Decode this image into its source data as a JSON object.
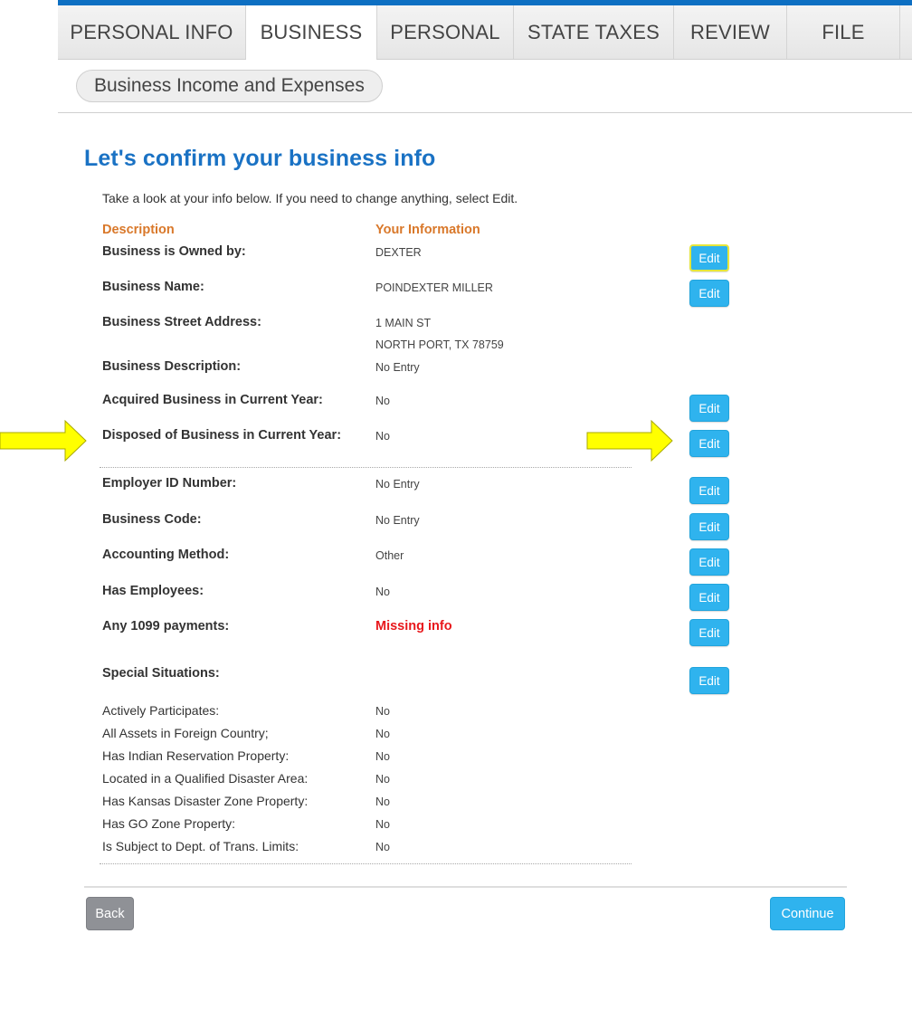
{
  "tabs": [
    {
      "label": "PERSONAL INFO"
    },
    {
      "label": "BUSINESS"
    },
    {
      "label": "PERSONAL"
    },
    {
      "label": "STATE TAXES"
    },
    {
      "label": "REVIEW"
    },
    {
      "label": "FILE"
    }
  ],
  "active_tab": "BUSINESS",
  "subnav": {
    "label": "Business Income and Expenses"
  },
  "page": {
    "title": "Let's confirm your business info",
    "intro": "Take a look at your info below. If you need to change anything, select Edit.",
    "col_description": "Description",
    "col_info": "Your Information"
  },
  "rows": {
    "owned_by": {
      "label": "Business is Owned by:",
      "value": "DEXTER"
    },
    "name": {
      "label": "Business Name:",
      "value": "POINDEXTER MILLER"
    },
    "address": {
      "label": "Business Street Address:",
      "line1": "1 MAIN ST",
      "line2": "NORTH PORT, TX 78759"
    },
    "description": {
      "label": "Business Description:",
      "value": "No Entry"
    },
    "acquired": {
      "label": "Acquired Business in Current Year:",
      "value": "No"
    },
    "disposed": {
      "label": "Disposed of Business in Current Year:",
      "value": "No"
    },
    "ein": {
      "label": "Employer ID Number:",
      "value": "No Entry"
    },
    "code": {
      "label": "Business Code:",
      "value": "No Entry"
    },
    "accounting": {
      "label": "Accounting Method:",
      "value": "Other"
    },
    "employees": {
      "label": "Has Employees:",
      "value": "No"
    },
    "payments_1099": {
      "label": "Any 1099 payments:",
      "value": "Missing info"
    },
    "special": {
      "label": "Special Situations:"
    }
  },
  "special_situations": [
    {
      "label": "Actively Participates:",
      "value": "No"
    },
    {
      "label": "All Assets in Foreign Country;",
      "value": "No"
    },
    {
      "label": "Has Indian Reservation Property:",
      "value": "No"
    },
    {
      "label": "Located in a Qualified Disaster Area:",
      "value": "No"
    },
    {
      "label": "Has Kansas Disaster Zone Property:",
      "value": "No"
    },
    {
      "label": "Has GO Zone Property:",
      "value": "No"
    },
    {
      "label": "Is Subject to Dept. of Trans. Limits:",
      "value": "No"
    }
  ],
  "buttons": {
    "edit": "Edit",
    "back": "Back",
    "continue": "Continue"
  },
  "colors": {
    "brand_blue": "#1a72c4",
    "button_blue": "#2fb3ee",
    "heading_orange": "#d9782a",
    "missing_red": "#e8181c",
    "arrow_yellow": "#ffff00"
  },
  "annotations": [
    "arrow-pointing-right",
    "arrow-pointing-right"
  ]
}
